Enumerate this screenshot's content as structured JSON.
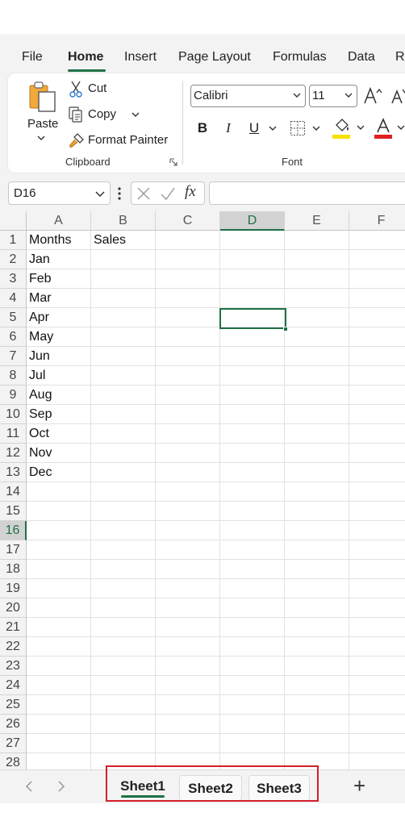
{
  "menu": {
    "items": [
      "File",
      "Home",
      "Insert",
      "Page Layout",
      "Formulas",
      "Data",
      "R"
    ],
    "active": "Home"
  },
  "ribbon": {
    "clipboard": {
      "paste": "Paste",
      "cut": "Cut",
      "copy": "Copy",
      "format_painter": "Format Painter",
      "group_label": "Clipboard"
    },
    "font": {
      "font_name": "Calibri",
      "font_size": "11",
      "bold": "B",
      "italic": "I",
      "underline": "U",
      "group_label": "Font",
      "fill_color": "#f5e200",
      "font_color": "#e02020"
    }
  },
  "formula_bar": {
    "name_box": "D16",
    "fx": "fx",
    "formula": ""
  },
  "grid": {
    "columns": [
      "A",
      "B",
      "C",
      "D",
      "E",
      "F"
    ],
    "selected_column": "D",
    "rows": [
      "1",
      "2",
      "3",
      "4",
      "5",
      "6",
      "7",
      "8",
      "9",
      "10",
      "11",
      "12",
      "13",
      "14",
      "15",
      "16",
      "17",
      "18",
      "19",
      "20",
      "21",
      "22",
      "23",
      "24",
      "25",
      "26",
      "27",
      "28"
    ],
    "selected_row": "16",
    "cells": {
      "A": [
        "Months",
        "Jan",
        "Feb",
        "Mar",
        "Apr",
        "May",
        "Jun",
        "Jul",
        "Aug",
        "Sep",
        "Oct",
        "Nov",
        "Dec"
      ],
      "B": [
        "Sales"
      ]
    }
  },
  "sheets": {
    "tabs": [
      "Sheet1",
      "Sheet2",
      "Sheet3"
    ],
    "active": "Sheet1",
    "add_label": "+"
  },
  "colors": {
    "accent": "#1e7145",
    "highlight_box": "#d31f2a"
  }
}
